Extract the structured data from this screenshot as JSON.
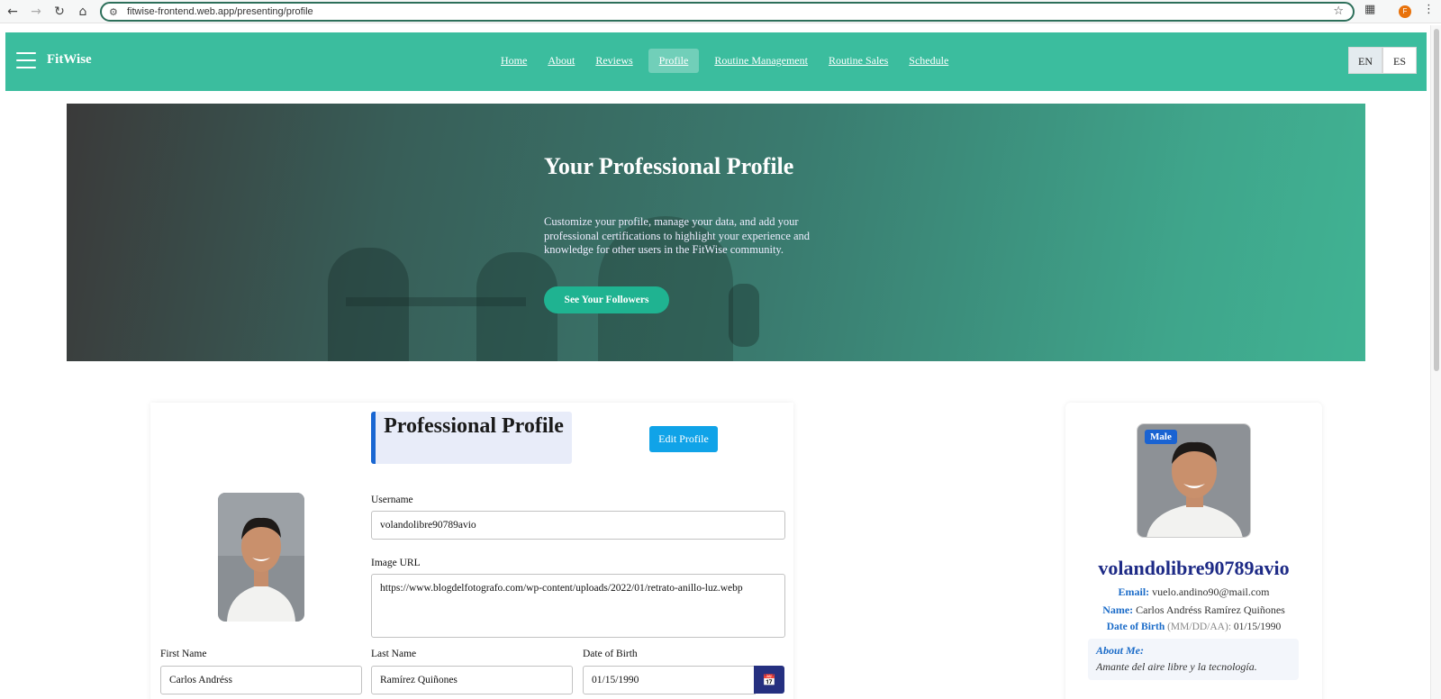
{
  "browser": {
    "url": "fitwise-frontend.web.app/presenting/profile",
    "avatar_letter": "F"
  },
  "navbar": {
    "brand": "FitWise",
    "links": [
      "Home",
      "About",
      "Reviews",
      "Profile",
      "Routine Management",
      "Routine Sales",
      "Schedule"
    ],
    "active_link": "Profile",
    "languages": [
      "EN",
      "ES"
    ],
    "active_language": "EN"
  },
  "hero": {
    "title": "Your Professional Profile",
    "text": "Customize your profile, manage your data, and add your professional certifications to highlight your experience and knowledge for other users in the FitWise community.",
    "button": "See Your Followers"
  },
  "form": {
    "heading": "Professional Profile",
    "edit_button": "Edit Profile",
    "username_label": "Username",
    "username_value": "volandolibre90789avio",
    "image_url_label": "Image URL",
    "image_url_value": "https://www.blogdelfotografo.com/wp-content/uploads/2022/01/retrato-anillo-luz.webp",
    "first_name_label": "First Name",
    "first_name_value": "Carlos Andréss",
    "last_name_label": "Last Name",
    "last_name_value": "Ramírez Quiñones",
    "dob_label": "Date of Birth",
    "dob_value": "01/15/1990"
  },
  "summary": {
    "gender_badge": "Male",
    "username": "volandolibre90789avio",
    "email_key": "Email:",
    "email_value": "vuelo.andino90@mail.com",
    "name_key": "Name:",
    "name_value": "Carlos Andréss Ramírez Quiñones",
    "dob_key": "Date of Birth",
    "dob_format": "(MM/DD/AA):",
    "dob_value": "01/15/1990",
    "about_title": "About Me:",
    "about_value": "Amante del aire libre y la tecnología."
  },
  "colors": {
    "navbar": "#3bbd9e",
    "hero_button": "#1fb391",
    "edit_button": "#10a3e8",
    "username_title": "#1d2a86",
    "accent_blue": "#1a6bc8"
  }
}
